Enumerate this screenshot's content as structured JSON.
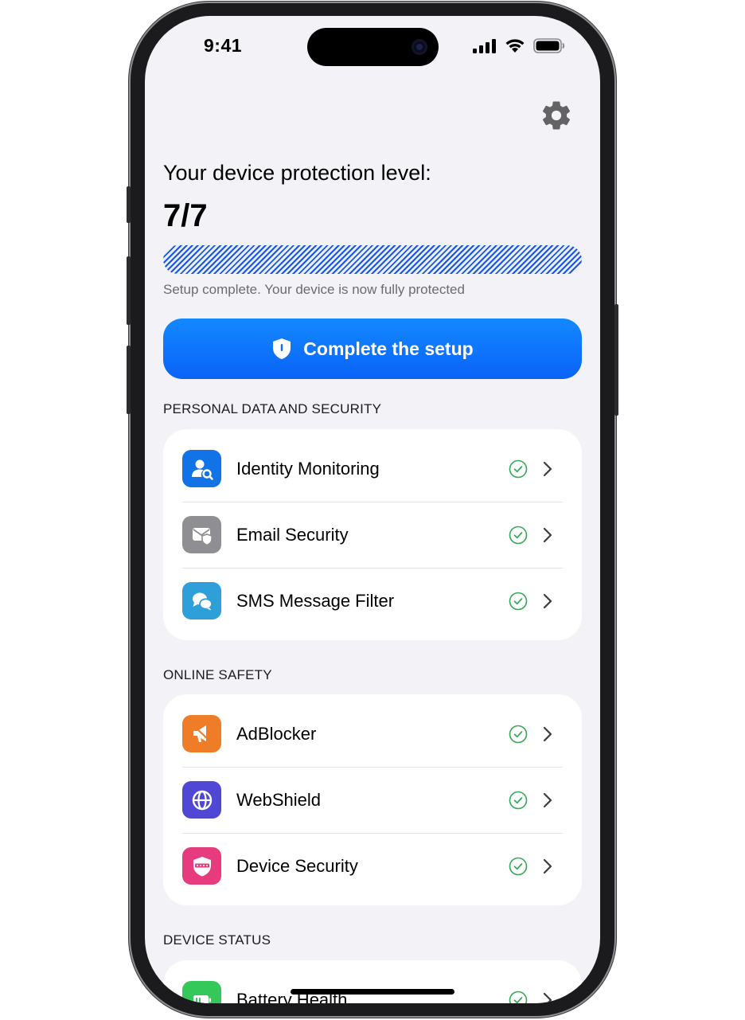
{
  "status_bar": {
    "time": "9:41",
    "icons": [
      "cellular-signal-icon",
      "wifi-icon",
      "battery-icon"
    ]
  },
  "header": {
    "settings_icon": "gear-icon"
  },
  "protection": {
    "title": "Your device protection level:",
    "score": "7/7",
    "progress_fraction": 1.0,
    "caption": "Setup complete. Your device is now fully protected"
  },
  "cta": {
    "label": "Complete the setup",
    "icon": "shield-icon"
  },
  "sections": [
    {
      "header": "PERSONAL DATA AND SECURITY",
      "items": [
        {
          "label": "Identity Monitoring",
          "icon": "identity-icon",
          "color": "#1273e6",
          "status": "enabled"
        },
        {
          "label": "Email Security",
          "icon": "email-shield-icon",
          "color": "#8e8e93",
          "status": "enabled"
        },
        {
          "label": "SMS Message Filter",
          "icon": "message-bubbles-icon",
          "color": "#2e9fd8",
          "status": "enabled"
        }
      ]
    },
    {
      "header": "ONLINE SAFETY",
      "items": [
        {
          "label": "AdBlocker",
          "icon": "megaphone-icon",
          "color": "#ef7d28",
          "status": "enabled"
        },
        {
          "label": "WebShield",
          "icon": "globe-icon",
          "color": "#5048d4",
          "status": "enabled"
        },
        {
          "label": "Device Security",
          "icon": "shield-password-icon",
          "color": "#e63c7d",
          "status": "enabled"
        }
      ]
    },
    {
      "header": "DEVICE STATUS",
      "items": [
        {
          "label": "Battery Health",
          "icon": "battery-health-icon",
          "color": "#34c759",
          "status": "enabled"
        }
      ]
    }
  ],
  "colors": {
    "accent": "#0a63f7",
    "check_green": "#34a853",
    "background": "#f2f2f7"
  }
}
